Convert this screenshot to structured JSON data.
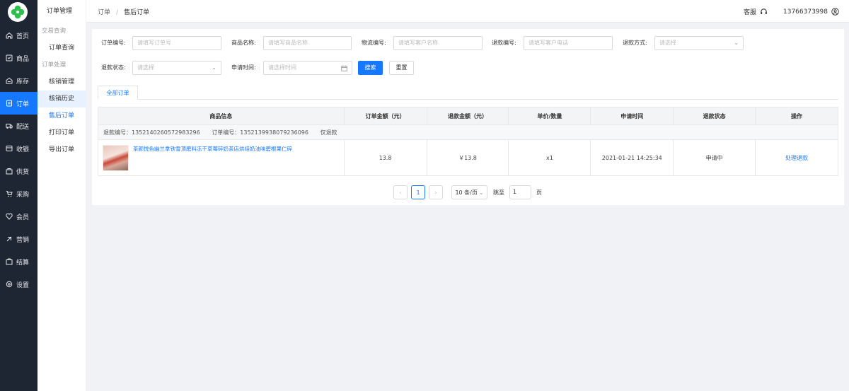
{
  "sidebar": {
    "items": [
      {
        "label": "首页",
        "icon": "home-icon"
      },
      {
        "label": "商品",
        "icon": "goods-icon"
      },
      {
        "label": "库存",
        "icon": "stock-icon"
      },
      {
        "label": "订单",
        "icon": "order-icon"
      },
      {
        "label": "配送",
        "icon": "truck-icon"
      },
      {
        "label": "收银",
        "icon": "cashier-icon"
      },
      {
        "label": "供货",
        "icon": "supply-icon"
      },
      {
        "label": "采购",
        "icon": "cart-icon"
      },
      {
        "label": "会员",
        "icon": "member-icon"
      },
      {
        "label": "营销",
        "icon": "marketing-icon"
      },
      {
        "label": "结算",
        "icon": "settle-icon"
      },
      {
        "label": "设置",
        "icon": "settings-icon"
      }
    ],
    "active_index": 3
  },
  "submenu": {
    "title": "订单管理",
    "group1": "交易查询",
    "item_query": "订单查询",
    "group2": "订单处理",
    "item_verify": "核销管理",
    "item_verify_history": "核销历史",
    "item_aftersale": "售后订单",
    "item_print": "打印订单",
    "item_export": "导出订单"
  },
  "breadcrumb": {
    "root": "订单",
    "sep": "/",
    "current": "售后订单"
  },
  "header": {
    "service": "客服",
    "phone": "13766373998"
  },
  "filters": {
    "order_no_label": "订单编号:",
    "order_no_placeholder": "请填写订单号",
    "product_label": "商品名称:",
    "product_placeholder": "请填写商品名称",
    "logistics_label": "物流编号:",
    "logistics_placeholder": "请填写客户名称",
    "refund_no_label": "退款编号:",
    "refund_no_placeholder": "请填写客户电话",
    "refund_method_label": "退款方式:",
    "refund_method_placeholder": "请选择",
    "refund_status_label": "退款状态:",
    "refund_status_placeholder": "请选择",
    "apply_time_label": "申请时间:",
    "apply_time_placeholder": "请选择时间",
    "search_button": "搜索",
    "reset_button": "重置"
  },
  "tabs": {
    "all": "全部订单"
  },
  "table": {
    "headers": [
      "商品信息",
      "订单金额（元）",
      "退款金额（元）",
      "单价/数量",
      "申请时间",
      "退款状态",
      "操作"
    ],
    "rows": [
      {
        "refund_no": "退款编号：1352140260572983296",
        "order_no": "订单编号：1352139938079236096",
        "refund_type": "仅退款",
        "product_name": "茶颜悦色幽兰拿铁雪顶磨料冻干草莓碎奶茶店烘焙奶油味碧根果仁碎",
        "order_amount": "13.8",
        "refund_amount": "￥13.8",
        "qty": "x1",
        "apply_time": "2021-01-21 14:25:34",
        "status": "申请中",
        "action": "处理退款"
      }
    ]
  },
  "pagination": {
    "prev": "‹",
    "current": "1",
    "next": "›",
    "page_size": "10 条/页",
    "jump_label": "跳至",
    "jump_value": "1",
    "page_suffix": "页"
  }
}
